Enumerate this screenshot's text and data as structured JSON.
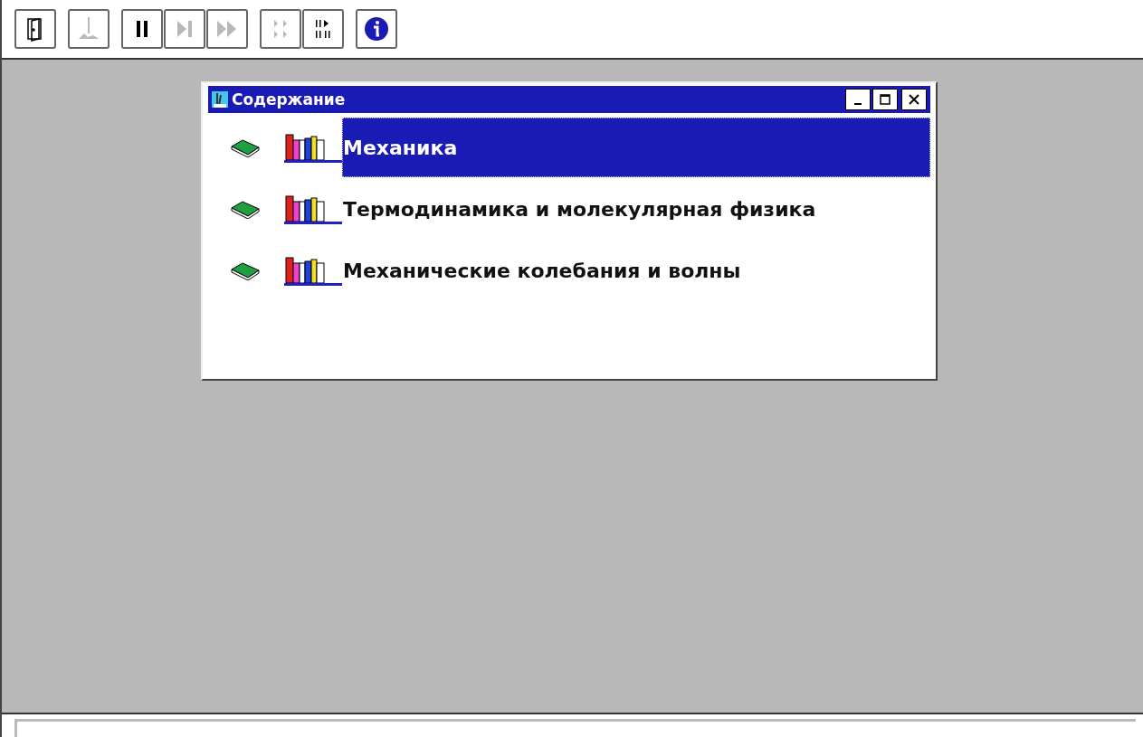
{
  "toolbar": [
    {
      "kind": "exit",
      "disabled": false
    },
    {
      "kind": "experiment",
      "disabled": true
    },
    {
      "kind": "pause",
      "disabled": false
    },
    {
      "kind": "step",
      "disabled": true
    },
    {
      "kind": "forward",
      "disabled": true
    },
    {
      "kind": "grid-play",
      "disabled": true
    },
    {
      "kind": "bars-play",
      "disabled": false
    },
    {
      "kind": "info",
      "disabled": false
    }
  ],
  "window": {
    "title": "Содержание"
  },
  "items": [
    {
      "label": "Механика",
      "selected": true
    },
    {
      "label": "Термодинамика и молекулярная физика",
      "selected": false
    },
    {
      "label": "Механические колебания и волны",
      "selected": false
    }
  ]
}
